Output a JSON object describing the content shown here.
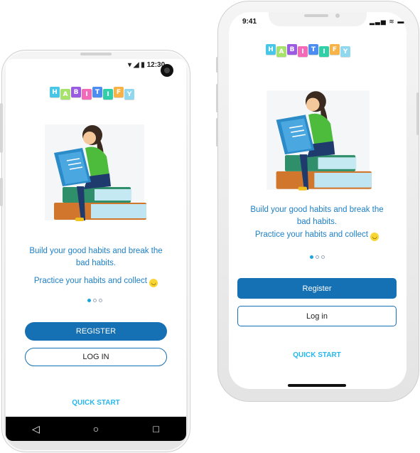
{
  "app": {
    "logo_letters": [
      "H",
      "A",
      "B",
      "I",
      "T",
      "I",
      "F",
      "Y"
    ],
    "logo_colors": [
      "#47c6e8",
      "#a6e36a",
      "#9a5be0",
      "#f46ab8",
      "#4d8df0",
      "#2fd0a8",
      "#f7b347",
      "#90d7f0"
    ]
  },
  "android": {
    "status_time": "12:30",
    "description_line1": "Build your good habits and break the",
    "description_line2": "bad habits.",
    "description_line3": "Practice your habits and collect",
    "register_label": "REGISTER",
    "login_label": "LOG IN",
    "quick_start_label": "QUICK START"
  },
  "ios": {
    "status_time": "9:41",
    "description_line1": "Build your good habits and break the",
    "description_line2": "bad habits.",
    "description_line3": "Practice your habits and collect",
    "register_label": "Register",
    "login_label": "Log in",
    "quick_start_label": "QUICK START"
  },
  "pager": {
    "total": 3,
    "active": 0
  },
  "colors": {
    "primary": "#1570b4",
    "accent": "#25b7ec",
    "text_blue": "#1d7fc6"
  }
}
